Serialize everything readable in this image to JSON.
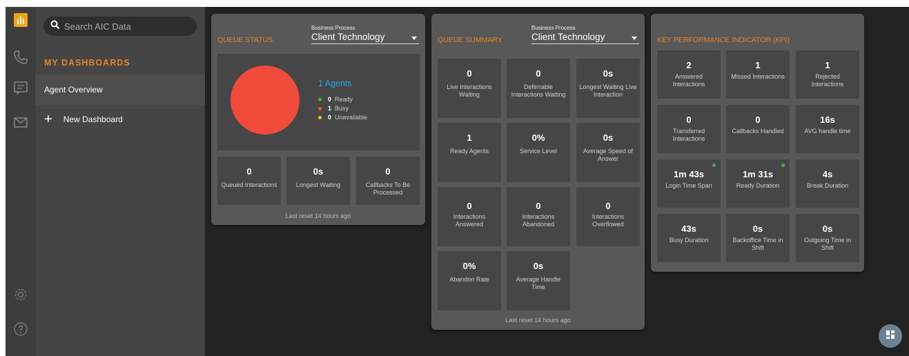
{
  "sidebar": {
    "search_placeholder": "Search AIC Data",
    "section_title": "MY DASHBOARDS",
    "items": [
      {
        "label": "Agent Overview"
      },
      {
        "label": "New Dashboard"
      }
    ]
  },
  "queue_status": {
    "title": "QUEUE STATUS",
    "bp_label": "Business Process",
    "bp_value": "Client Technology",
    "agents_label": "1 Agents",
    "legend": [
      {
        "value": "0",
        "label": "Ready",
        "color": "#4caf50"
      },
      {
        "value": "1",
        "label": "Busy",
        "color": "#f04b3a"
      },
      {
        "value": "0",
        "label": "Unavailable",
        "color": "#f5c518"
      }
    ],
    "tiles": [
      {
        "value": "0",
        "label": "Queued Interactions"
      },
      {
        "value": "0s",
        "label": "Longest Waiting"
      },
      {
        "value": "0",
        "label": "Callbacks To Be Processed"
      }
    ],
    "reset": "Last reset 14 hours ago"
  },
  "queue_summary": {
    "title": "QUEUE SUMMARY",
    "bp_label": "Business Process",
    "bp_value": "Client Technology",
    "tiles": [
      {
        "value": "0",
        "label": "Live Interactions Waiting"
      },
      {
        "value": "0",
        "label": "Deferrable Interactions Waiting"
      },
      {
        "value": "0s",
        "label": "Longest Waiting Live Interaction"
      },
      {
        "value": "1",
        "label": "Ready Agents"
      },
      {
        "value": "0%",
        "label": "Service Level"
      },
      {
        "value": "0s",
        "label": "Average Speed of Answer"
      },
      {
        "value": "0",
        "label": "Interactions Answered"
      },
      {
        "value": "0",
        "label": "Interactions Abandoned"
      },
      {
        "value": "0",
        "label": "Interactions Overflowed"
      },
      {
        "value": "0%",
        "label": "Abandon Rate"
      },
      {
        "value": "0s",
        "label": "Average Handle Time"
      }
    ],
    "reset": "Last reset 14 hours ago"
  },
  "kpi": {
    "title": "KEY PERFORMANCE INDICATOR (KPI)",
    "tiles": [
      {
        "value": "2",
        "label": "Answered Interactions"
      },
      {
        "value": "1",
        "label": "Missed Interactions"
      },
      {
        "value": "1",
        "label": "Rejected Interactions"
      },
      {
        "value": "0",
        "label": "Transferred Interactions"
      },
      {
        "value": "0",
        "label": "Callbacks Handled"
      },
      {
        "value": "16s",
        "label": "AVG handle time"
      },
      {
        "value": "1m 43s",
        "label": "Login Time Span"
      },
      {
        "value": "1m 31s",
        "label": "Ready Duration"
      },
      {
        "value": "4s",
        "label": "Break Duration"
      },
      {
        "value": "43s",
        "label": "Busy Duration"
      },
      {
        "value": "0s",
        "label": "Backoffice Time in Shift"
      },
      {
        "value": "0s",
        "label": "Outgoing Time in Shift"
      }
    ]
  },
  "colors": {
    "accent": "#e8832a",
    "info": "#27a7e0",
    "online": "#4caf50"
  },
  "icons": [
    "dashboard-icon",
    "phone-icon",
    "chat-icon",
    "mail-icon",
    "settings-icon",
    "help-icon",
    "search-icon",
    "grid-icon"
  ]
}
